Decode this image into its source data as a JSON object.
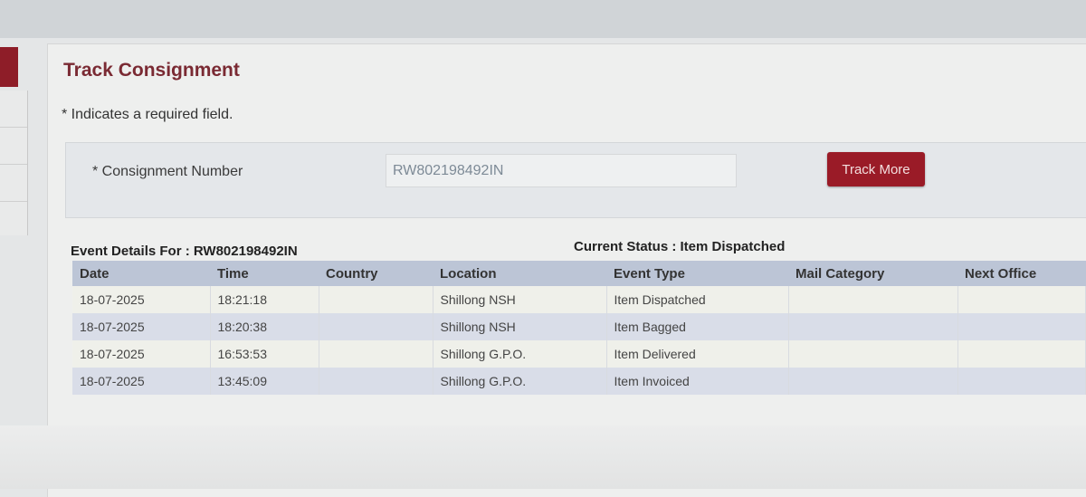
{
  "page": {
    "title": "Track Consignment",
    "required_note": "* Indicates a required field."
  },
  "form": {
    "consignment_label": "* Consignment Number",
    "consignment_value": "RW802198492IN",
    "track_button_label": "Track More"
  },
  "results": {
    "event_details_label": "Event Details For : RW802198492IN",
    "current_status_label": "Current Status : Item Dispatched",
    "columns": [
      "Date",
      "Time",
      "Country",
      "Location",
      "Event Type",
      "Mail Category",
      "Next Office"
    ],
    "rows": [
      {
        "date": "18-07-2025",
        "time": "18:21:18",
        "country": "",
        "location": "Shillong NSH",
        "event_type": "Item Dispatched",
        "mail_category": "",
        "next_office": ""
      },
      {
        "date": "18-07-2025",
        "time": "18:20:38",
        "country": "",
        "location": "Shillong NSH",
        "event_type": "Item Bagged",
        "mail_category": "",
        "next_office": ""
      },
      {
        "date": "18-07-2025",
        "time": "16:53:53",
        "country": "",
        "location": "Shillong G.P.O.",
        "event_type": "Item Delivered",
        "mail_category": "",
        "next_office": ""
      },
      {
        "date": "18-07-2025",
        "time": "13:45:09",
        "country": "",
        "location": "Shillong G.P.O.",
        "event_type": "Item Invoiced",
        "mail_category": "",
        "next_office": ""
      }
    ]
  },
  "colors": {
    "accent": "#9a1b27",
    "title": "#7a2a33",
    "table_header": "#bcc5d6"
  }
}
